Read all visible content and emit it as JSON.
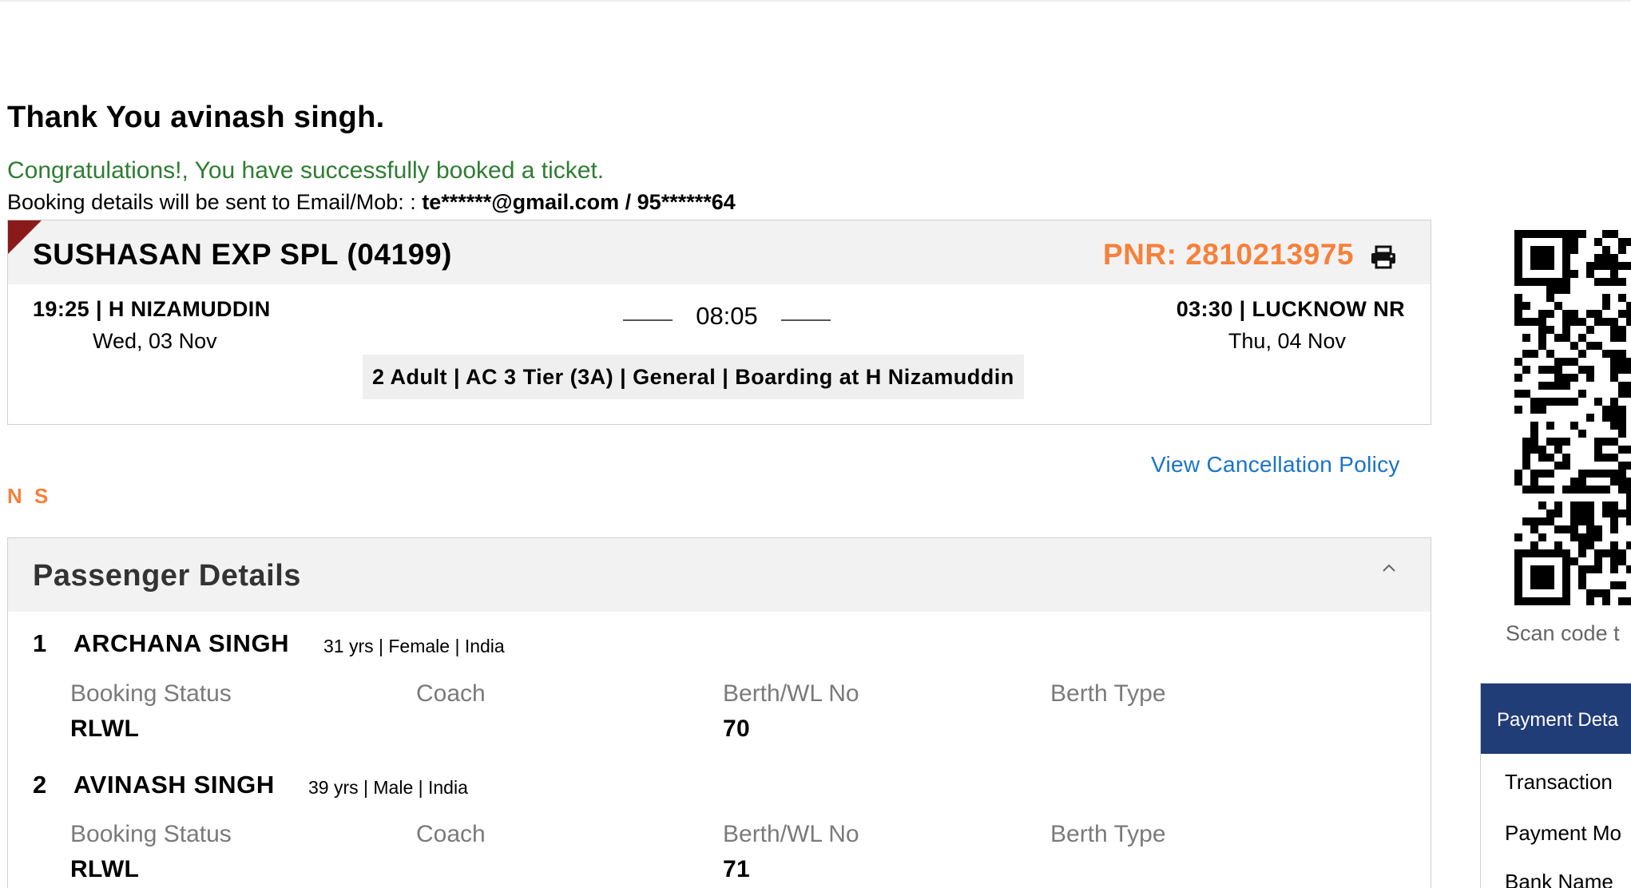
{
  "greeting": "Thank You avinash singh.",
  "congrats": "Congratulations!, You have successfully booked a ticket.",
  "contact": {
    "prefix": "Booking details will be sent to Email/Mob: : ",
    "value": "te******@gmail.com / 95******64"
  },
  "journey": {
    "train": "SUSHASAN EXP SPL (04199)",
    "pnr": "PNR: 2810213975",
    "departure_time": "19:25 | H NIZAMUDDIN",
    "departure_date": "Wed, 03 Nov",
    "duration": "08:05",
    "arrival_time": "03:30 | LUCKNOW NR",
    "arrival_date": "Thu, 04 Nov",
    "summary": "2 Adult | AC 3 Tier (3A) | General | Boarding at H Nizamuddin"
  },
  "cancellation_link": "View Cancellation Policy",
  "ns_label": "N S",
  "passenger_section": {
    "title": "Passenger Details",
    "columns": [
      "Booking Status",
      "Coach",
      "Berth/WL No",
      "Berth Type"
    ],
    "passengers": [
      {
        "num": "1",
        "name": "ARCHANA SINGH",
        "meta": "31 yrs | Female | India",
        "status": "RLWL",
        "coach": "",
        "berth": "70",
        "berth_type": ""
      },
      {
        "num": "2",
        "name": "AVINASH SINGH",
        "meta": "39 yrs | Male | India",
        "status": "RLWL",
        "coach": "",
        "berth": "71",
        "berth_type": ""
      }
    ]
  },
  "qr": {
    "caption": "Scan code t"
  },
  "payment": {
    "title": "Payment Deta",
    "rows": [
      "Transaction",
      "Payment Mo",
      "Bank Name"
    ]
  },
  "icons": {
    "print": "print-icon",
    "collapse": "chevron-up-icon",
    "qr": "qr-code-icon"
  },
  "colors": {
    "pnr": "#f5813b",
    "congrats": "#2e7d32",
    "link": "#1a73c8",
    "payment_header": "#213d77",
    "ribbon": "#8b1a1a"
  }
}
